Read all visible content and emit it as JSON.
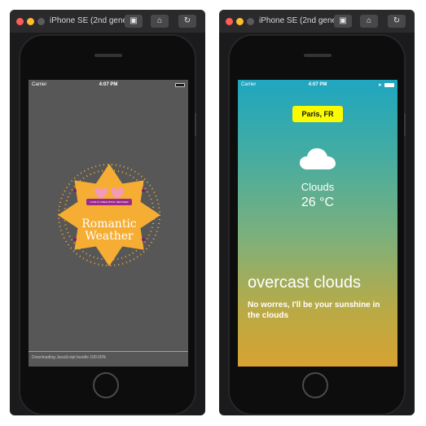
{
  "left_simulator": {
    "title": "iPhone SE (2nd gener...",
    "status": {
      "carrier": "Carrier",
      "time": "4:07 PM"
    },
    "badge": {
      "banner": "LOVE IS A BEAUTIFUL WEATHER",
      "title_line1": "Romantic",
      "title_line2": "Weather"
    },
    "loader_text": "Downloading JavaScript bundle 100.00%"
  },
  "right_simulator": {
    "title": "iPhone SE (2nd gener...",
    "status": {
      "carrier": "Carrier",
      "time": "4:07 PM"
    },
    "city_button": "Paris, FR",
    "condition": "Clouds",
    "temperature": "26 °C",
    "description": "overcast clouds",
    "message": "No worres, I'll be your sunshine in the clouds"
  },
  "toolbar_icons": [
    "screenshot-icon",
    "home-icon",
    "rotate-icon"
  ],
  "colors": {
    "badge_orange": "#f5ad33",
    "badge_dots": "#f5ad33",
    "city_button": "#fbfb00",
    "gradient_top": "#1fa6c0",
    "gradient_bottom": "#d7a232"
  }
}
